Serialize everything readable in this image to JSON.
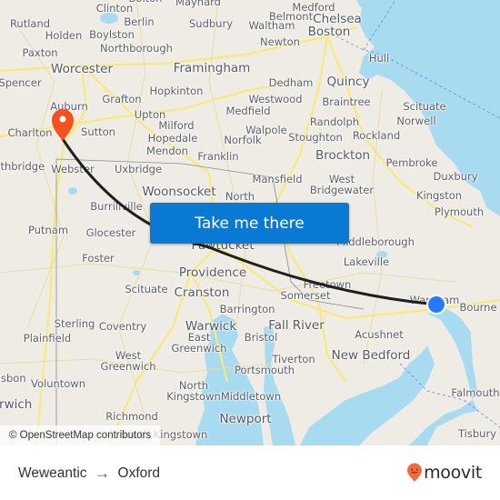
{
  "map": {
    "attribution": "© OpenStreetMap contributors",
    "origin_marker": {
      "name": "Weweantic",
      "color": "#2979ff"
    },
    "destination_marker": {
      "name": "Oxford",
      "color": "#f4511e"
    },
    "colors": {
      "land": "#efece6",
      "water": "#a8daf0",
      "roads": "#f8e97a",
      "route": "#1f1f1f"
    },
    "places": [
      {
        "name": "Clinton"
      },
      {
        "name": "Bolton"
      },
      {
        "name": "Maynard"
      },
      {
        "name": "Medford"
      },
      {
        "name": "Rutland"
      },
      {
        "name": "Berlin"
      },
      {
        "name": "Sudbury"
      },
      {
        "name": "Belmont"
      },
      {
        "name": "Chelsea"
      },
      {
        "name": "Holden"
      },
      {
        "name": "Boylston"
      },
      {
        "name": "Waltham"
      },
      {
        "name": "Boston"
      },
      {
        "name": "Northborough"
      },
      {
        "name": "Newton"
      },
      {
        "name": "Paxton"
      },
      {
        "name": "Hull"
      },
      {
        "name": "Worcester"
      },
      {
        "name": "Framingham"
      },
      {
        "name": "Spencer"
      },
      {
        "name": "Dedham"
      },
      {
        "name": "Quincy"
      },
      {
        "name": "Hopkinton"
      },
      {
        "name": "Grafton"
      },
      {
        "name": "Westwood"
      },
      {
        "name": "Braintree"
      },
      {
        "name": "Auburn"
      },
      {
        "name": "Upton"
      },
      {
        "name": "Medfield"
      },
      {
        "name": "Scituate"
      },
      {
        "name": "Milford"
      },
      {
        "name": "Randolph"
      },
      {
        "name": "Norwell"
      },
      {
        "name": "Charlton"
      },
      {
        "name": "Sutton"
      },
      {
        "name": "Hopedale"
      },
      {
        "name": "Walpole"
      },
      {
        "name": "Norfolk"
      },
      {
        "name": "Stoughton"
      },
      {
        "name": "Rockland"
      },
      {
        "name": "Mendon"
      },
      {
        "name": "Franklin"
      },
      {
        "name": "Brockton"
      },
      {
        "name": "Southbridge"
      },
      {
        "name": "Webster"
      },
      {
        "name": "Uxbridge"
      },
      {
        "name": "Pembroke"
      },
      {
        "name": "Mansfield"
      },
      {
        "name": "West Bridgewater"
      },
      {
        "name": "Duxbury"
      },
      {
        "name": "Woonsocket"
      },
      {
        "name": "North"
      },
      {
        "name": "Kingston"
      },
      {
        "name": "Burrillville"
      },
      {
        "name": "Plymouth"
      },
      {
        "name": "Putnam"
      },
      {
        "name": "Glocester"
      },
      {
        "name": "Pawtucket"
      },
      {
        "name": "Middleborough"
      },
      {
        "name": "Foster"
      },
      {
        "name": "Providence"
      },
      {
        "name": "Lakeville"
      },
      {
        "name": "Freetown"
      },
      {
        "name": "Scituate"
      },
      {
        "name": "Cranston"
      },
      {
        "name": "Somerset"
      },
      {
        "name": "Wareham"
      },
      {
        "name": "Bourne"
      },
      {
        "name": "Barrington"
      },
      {
        "name": "Sterling"
      },
      {
        "name": "Coventry"
      },
      {
        "name": "Warwick"
      },
      {
        "name": "Fall River"
      },
      {
        "name": "Plainfield"
      },
      {
        "name": "East Greenwich"
      },
      {
        "name": "Bristol"
      },
      {
        "name": "Acushnet"
      },
      {
        "name": "West Greenwich"
      },
      {
        "name": "Tiverton"
      },
      {
        "name": "New Bedford"
      },
      {
        "name": "Portsmouth"
      },
      {
        "name": "Lisbon"
      },
      {
        "name": "Voluntown"
      },
      {
        "name": "North Kingstown"
      },
      {
        "name": "Middletown"
      },
      {
        "name": "Falmouth"
      },
      {
        "name": "Norwich"
      },
      {
        "name": "Richmond"
      },
      {
        "name": "Newport"
      },
      {
        "name": "South Kingstown"
      },
      {
        "name": "Tisbury"
      }
    ]
  },
  "cta": {
    "label": "Take me there"
  },
  "footer": {
    "origin": "Weweantic",
    "arrow": "→",
    "destination": "Oxford",
    "brand": "moovit",
    "brand_color": "#f26b3a"
  }
}
